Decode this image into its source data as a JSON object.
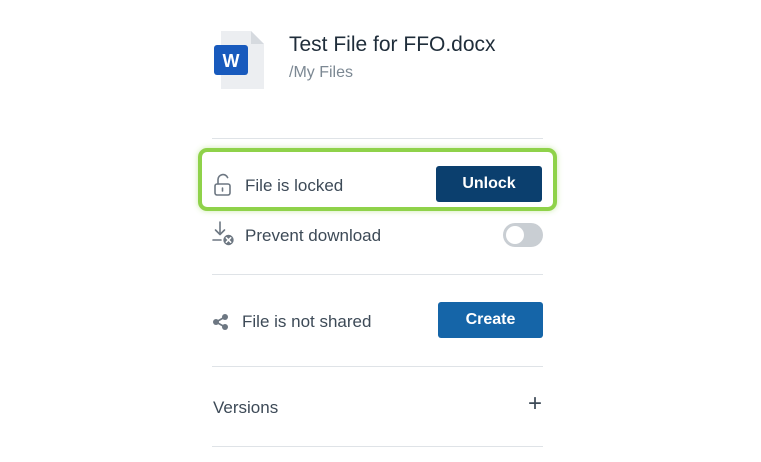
{
  "file": {
    "name": "Test File for FFO.docx",
    "path": "/My Files",
    "type_badge": "W",
    "icon": "word-document-icon"
  },
  "lock": {
    "icon": "unlocked-padlock-icon",
    "status_label": "File is locked",
    "button_label": "Unlock"
  },
  "prevent_download": {
    "icon": "download-blocked-icon",
    "label": "Prevent download",
    "enabled": false
  },
  "sharing": {
    "icon": "share-icon",
    "status_label": "File is not shared",
    "button_label": "Create"
  },
  "versions": {
    "label": "Versions",
    "expand_icon": "plus-icon",
    "expand_glyph": "+"
  },
  "colors": {
    "unlock_button": "#0b3f6e",
    "create_button": "#1565a8",
    "highlight_border": "#8fd24a",
    "word_blue": "#185abd"
  }
}
